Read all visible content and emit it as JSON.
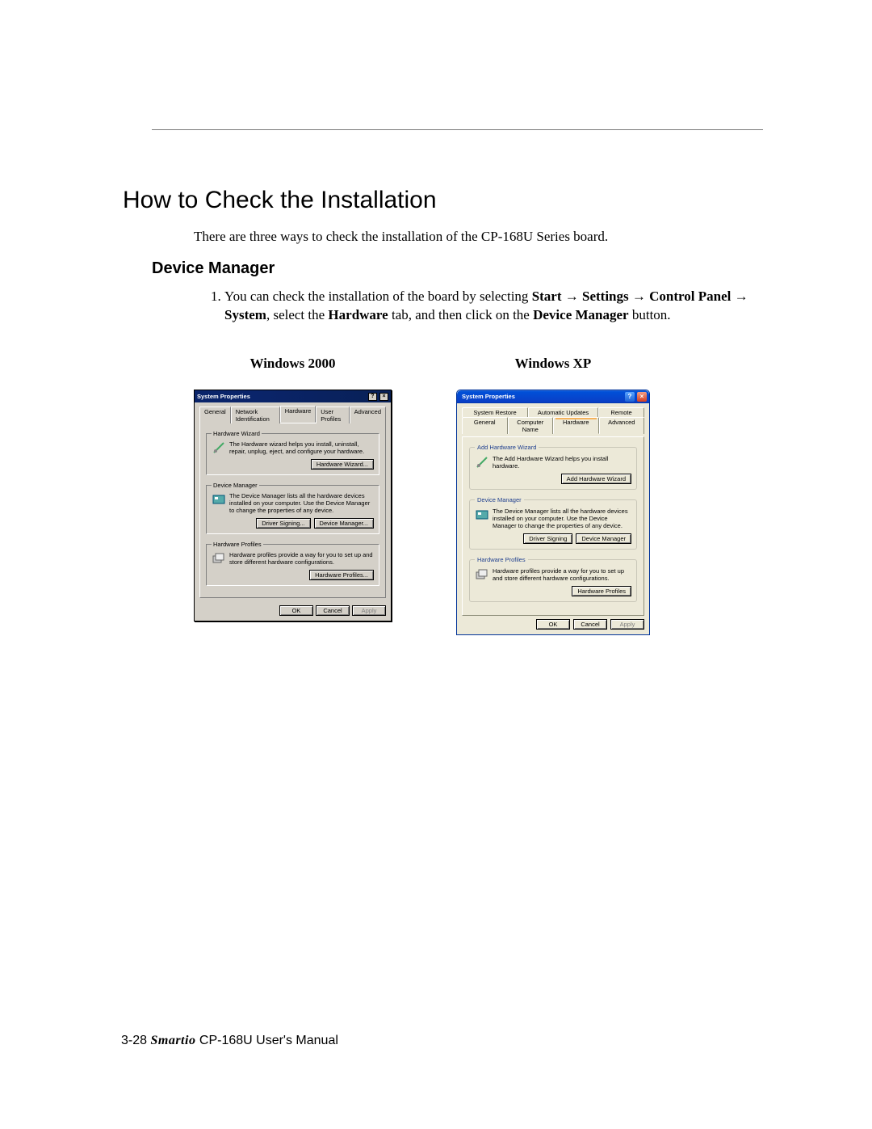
{
  "page": {
    "h1": "How to Check the Installation",
    "intro": "There are three ways to check the installation of the CP-168U Series board.",
    "h2": "Device Manager",
    "step1_pre": "You can check the installation of the board by selecting ",
    "step1_path_start": "Start",
    "step1_path_settings": "Settings",
    "step1_path_cp": "Control Panel",
    "step1_path_system": "System",
    "step1_mid": ", select the ",
    "step1_hw": "Hardware",
    "step1_mid2": " tab, and then click on the ",
    "step1_dm": "Device Manager",
    "step1_end": " button.",
    "arrow": "→",
    "col1_heading": "Windows 2000",
    "col2_heading": "Windows XP"
  },
  "win2k": {
    "title": "System Properties",
    "tabs": {
      "general": "General",
      "netid": "Network Identification",
      "hardware": "Hardware",
      "userprofiles": "User Profiles",
      "advanced": "Advanced"
    },
    "hw_wizard": {
      "legend": "Hardware Wizard",
      "text": "The Hardware wizard helps you install, uninstall, repair, unplug, eject, and configure your hardware.",
      "btn": "Hardware Wizard..."
    },
    "dm": {
      "legend": "Device Manager",
      "text": "The Device Manager lists all the hardware devices installed on your computer. Use the Device Manager to change the properties of any device.",
      "btn_sign": "Driver Signing...",
      "btn_dm": "Device Manager..."
    },
    "hp": {
      "legend": "Hardware Profiles",
      "text": "Hardware profiles provide a way for you to set up and store different hardware configurations.",
      "btn": "Hardware Profiles..."
    },
    "buttons": {
      "ok": "OK",
      "cancel": "Cancel",
      "apply": "Apply"
    }
  },
  "winxp": {
    "title": "System Properties",
    "tabs_row1": {
      "sysrestore": "System Restore",
      "autoupdates": "Automatic Updates",
      "remote": "Remote"
    },
    "tabs_row2": {
      "general": "General",
      "compname": "Computer Name",
      "hardware": "Hardware",
      "advanced": "Advanced"
    },
    "add_hw": {
      "legend": "Add Hardware Wizard",
      "text": "The Add Hardware Wizard helps you install hardware.",
      "btn": "Add Hardware Wizard"
    },
    "dm": {
      "legend": "Device Manager",
      "text": "The Device Manager lists all the hardware devices installed on your computer. Use the Device Manager to change the properties of any device.",
      "btn_sign": "Driver Signing",
      "btn_dm": "Device Manager"
    },
    "hp": {
      "legend": "Hardware Profiles",
      "text": "Hardware profiles provide a way for you to set up and store different hardware configurations.",
      "btn": "Hardware Profiles"
    },
    "buttons": {
      "ok": "OK",
      "cancel": "Cancel",
      "apply": "Apply"
    }
  },
  "footer": {
    "pagenum": "3-28",
    "brand": "Smartio",
    "rest": " CP-168U User's Manual"
  }
}
